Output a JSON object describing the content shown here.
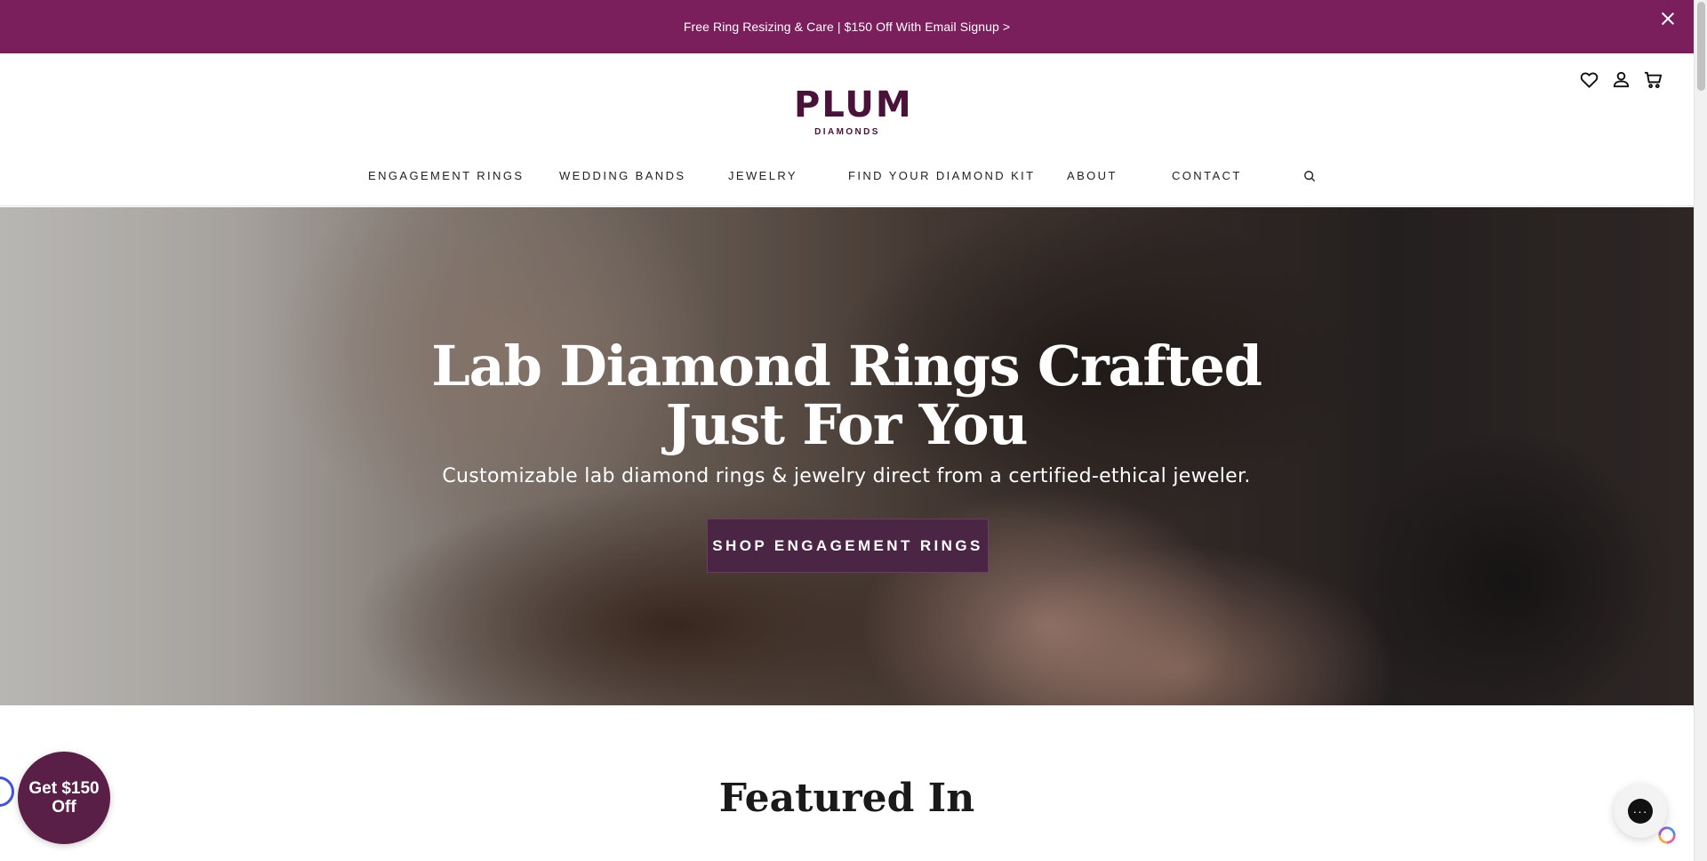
{
  "announcement": {
    "text": "Free Ring Resizing & Care | $150 Off With Email Signup >"
  },
  "header": {
    "logo": {
      "main": "PLUM",
      "sub": "DIAMONDS"
    },
    "icons": [
      "heart-icon",
      "account-icon",
      "cart-icon"
    ]
  },
  "nav": {
    "items": [
      {
        "label": "ENGAGEMENT RINGS"
      },
      {
        "label": "WEDDING BANDS"
      },
      {
        "label": "JEWELRY"
      },
      {
        "label": "FIND YOUR DIAMOND KIT"
      },
      {
        "label": "ABOUT"
      },
      {
        "label": "CONTACT"
      }
    ]
  },
  "hero": {
    "title": "Lab Diamond Rings Crafted Just For You",
    "subtitle": "Customizable lab diamond rings & jewelry direct from a certified-ethical jeweler.",
    "cta": "SHOP ENGAGEMENT RINGS"
  },
  "featured": {
    "heading": "Featured In"
  },
  "promo": {
    "text": "Get $150 Off"
  },
  "chat": {
    "icon": "chat-icon",
    "dots": "···"
  },
  "colors": {
    "announcement_bg": "#7a1f5c",
    "brand": "#4a1238",
    "cta_bg": "#4a2544",
    "promo_bg": "#5a1f47"
  }
}
